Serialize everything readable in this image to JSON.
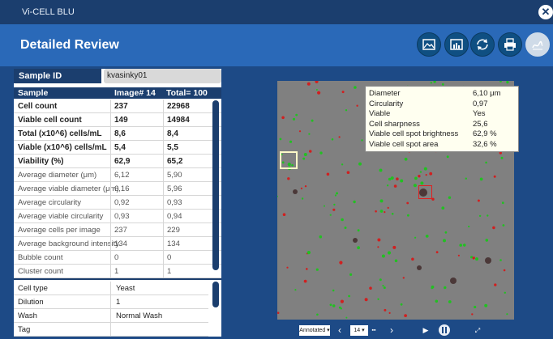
{
  "app": {
    "title": "Vi-CELL BLU"
  },
  "header": {
    "title": "Detailed Review"
  },
  "sample": {
    "id_label": "Sample ID",
    "id_value": "kvasinky01"
  },
  "table": {
    "headers": [
      "Sample",
      "Image# 14",
      "Total= 100"
    ],
    "rows": [
      [
        "Cell count",
        "237",
        "22968"
      ],
      [
        "Viable cell count",
        "149",
        "14984"
      ],
      [
        "Total (x10^6) cells/mL",
        "8,6",
        "8,4"
      ],
      [
        "Viable (x10^6) cells/mL",
        "5,4",
        "5,5"
      ],
      [
        "Viability (%)",
        "62,9",
        "65,2"
      ],
      [
        "Average diameter (μm)",
        "6,12",
        "5,90"
      ],
      [
        "Average viable diameter (μm)",
        "6,16",
        "5,96"
      ],
      [
        "Average circularity",
        "0,92",
        "0,93"
      ],
      [
        "Average viable circularity",
        "0,93",
        "0,94"
      ],
      [
        "Average cells per image",
        "237",
        "229"
      ],
      [
        "Average background intensity",
        "134",
        "134"
      ],
      [
        "Bubble count",
        "0",
        "0"
      ],
      [
        "Cluster count",
        "1",
        "1"
      ]
    ]
  },
  "meta": {
    "rows": [
      [
        "Cell type",
        "Yeast"
      ],
      [
        "Dilution",
        "1"
      ],
      [
        "Wash",
        "Normal Wash"
      ],
      [
        "Tag",
        ""
      ]
    ]
  },
  "tooltip": {
    "rows": [
      [
        "Diameter",
        "6,10 μm"
      ],
      [
        "Circularity",
        "0,97"
      ],
      [
        "Viable",
        "Yes"
      ],
      [
        "Cell sharpness",
        "25,6"
      ],
      [
        "Viable cell spot brightness",
        "62,9 %"
      ],
      [
        "Viable cell spot area",
        "32,6 %"
      ]
    ]
  },
  "controls": {
    "mode": "Annotated",
    "image_no": "14"
  },
  "colors": {
    "title_bar": "#1b3e6e",
    "header": "#2a69b8",
    "panel": "#1d4a86",
    "viable_marker": "#22c022",
    "nonviable_marker": "#d02020"
  }
}
